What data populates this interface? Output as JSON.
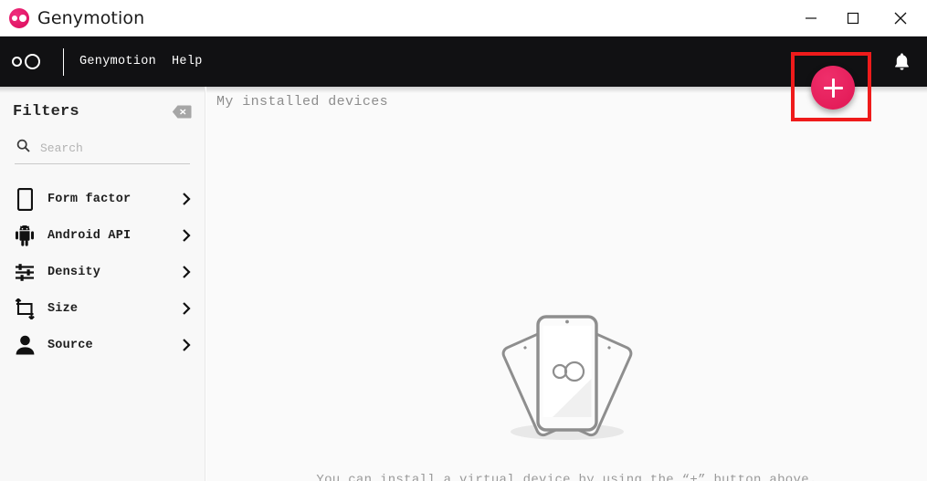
{
  "window": {
    "app_name": "Genymotion",
    "logo_icon": "genymotion-oo-logo",
    "controls": {
      "minimize": "minimize-icon",
      "maximize": "maximize-icon",
      "close": "close-icon"
    }
  },
  "navbar": {
    "logo_icon": "genymotion-oo-logo",
    "links": [
      {
        "label": "Genymotion",
        "name": "nav-link-genymotion"
      },
      {
        "label": "Help",
        "name": "nav-link-help"
      }
    ],
    "notification_icon": "bell-icon",
    "add_device_button": {
      "icon": "plus-icon",
      "tooltip": "+",
      "color": "#e8245f",
      "highlighted": true,
      "highlight_color": "#ef1b1b"
    }
  },
  "sidebar": {
    "title": "Filters",
    "clear_button_icon": "clear-filters-icon",
    "search": {
      "icon": "search-icon",
      "placeholder": "Search",
      "value": ""
    },
    "items": [
      {
        "label": "Form factor",
        "icon": "phone-icon",
        "chevron": "chevron-right-icon"
      },
      {
        "label": "Android API",
        "icon": "android-icon",
        "chevron": "chevron-right-icon"
      },
      {
        "label": "Density",
        "icon": "sliders-icon",
        "chevron": "chevron-right-icon"
      },
      {
        "label": "Size",
        "icon": "crop-icon",
        "chevron": "chevron-right-icon"
      },
      {
        "label": "Source",
        "icon": "person-icon",
        "chevron": "chevron-right-icon"
      }
    ]
  },
  "main": {
    "title": "My installed devices",
    "empty_state": {
      "illustration": "three-phones-illustration",
      "message": "You can install a virtual device by using the “+” button above."
    }
  }
}
